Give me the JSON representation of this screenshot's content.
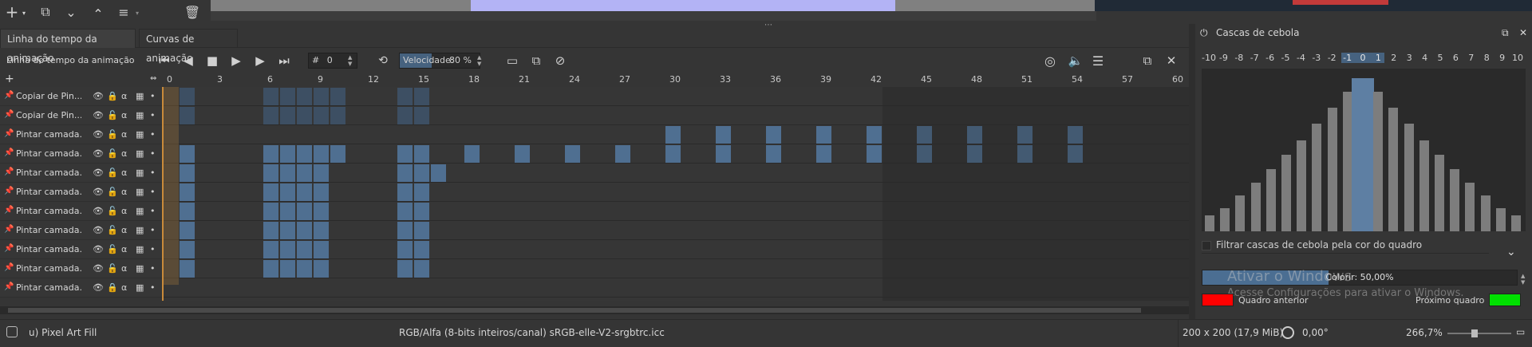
{
  "toolbar": {
    "icons": [
      "plus-icon",
      "copy-icon",
      "chevron-down-icon",
      "chevron-up-icon",
      "settings-icon",
      "trash-icon"
    ]
  },
  "tabs": [
    {
      "label": "Linha do tempo da animação"
    },
    {
      "label": "Curvas de animação"
    }
  ],
  "timeline": {
    "title": "Linha do tempo da animação",
    "frame_prefix": "#",
    "frame_value": "0",
    "speed_label": "Velocidade:",
    "speed_value": "80 %",
    "speed_fraction": 0.8
  },
  "ruler": {
    "ticks": [
      "0",
      "3",
      "6",
      "9",
      "12",
      "15",
      "18",
      "21",
      "24",
      "27",
      "30",
      "33",
      "36",
      "39",
      "42",
      "45",
      "48",
      "51",
      "54",
      "57",
      "60"
    ]
  },
  "layers": [
    {
      "name": "Copiar de Pin...",
      "locked": true
    },
    {
      "name": "Copiar de Pin...",
      "locked": false
    },
    {
      "name": "Pintar camada...",
      "locked": false
    },
    {
      "name": "Pintar camada...",
      "locked": false
    },
    {
      "name": "Pintar camada...",
      "locked": false
    },
    {
      "name": "Pintar camada...",
      "locked": false
    },
    {
      "name": "Pintar camada...",
      "locked": false
    },
    {
      "name": "Pintar camada...",
      "locked": false
    },
    {
      "name": "Pintar camada...",
      "locked": false
    },
    {
      "name": "Pintar camada...",
      "locked": false
    },
    {
      "name": "Pintar camada...",
      "locked": true
    }
  ],
  "layer_alpha_symbol": "α",
  "status": {
    "tool": "u) Pixel Art Fill",
    "color_space": "RGB/Alfa (8-bits inteiros/canal)  sRGB-elle-V2-srgbtrc.icc",
    "image_size": "200 x 200 (17,9 MiB)",
    "rotation": "0,00°",
    "zoom": "266,7%"
  },
  "onion": {
    "title": "Cascas de cebola",
    "numbers": [
      "-10",
      "-9",
      "-8",
      "-7",
      "-6",
      "-5",
      "-4",
      "-3",
      "-2",
      "-1",
      "0",
      "1",
      "2",
      "3",
      "4",
      "5",
      "6",
      "7",
      "8",
      "9",
      "10"
    ],
    "opacities": [
      0.1,
      0.14,
      0.22,
      0.3,
      0.38,
      0.47,
      0.56,
      0.66,
      0.76,
      0.86,
      0.94,
      0.86,
      0.76,
      0.66,
      0.56,
      0.47,
      0.38,
      0.3,
      0.22,
      0.14,
      0.1
    ],
    "filter_label": "Filtrar cascas de cebola pela cor do quadro",
    "opacity_label": "Colorir: 50,00%",
    "opacity_fraction": 0.4,
    "prev_label": "Quadro anterior",
    "next_label": "Próximo quadro",
    "prev_color": "#ff0000",
    "next_color": "#00e000"
  },
  "watermark": {
    "line1": "Ativar o Windows",
    "line2": "Acesse Configurações para ativar o Windows."
  },
  "colors": {
    "keyframe": "#4f6f91",
    "keyframe_dim": "#3d4f63",
    "current_frame": "#c98a3a"
  }
}
